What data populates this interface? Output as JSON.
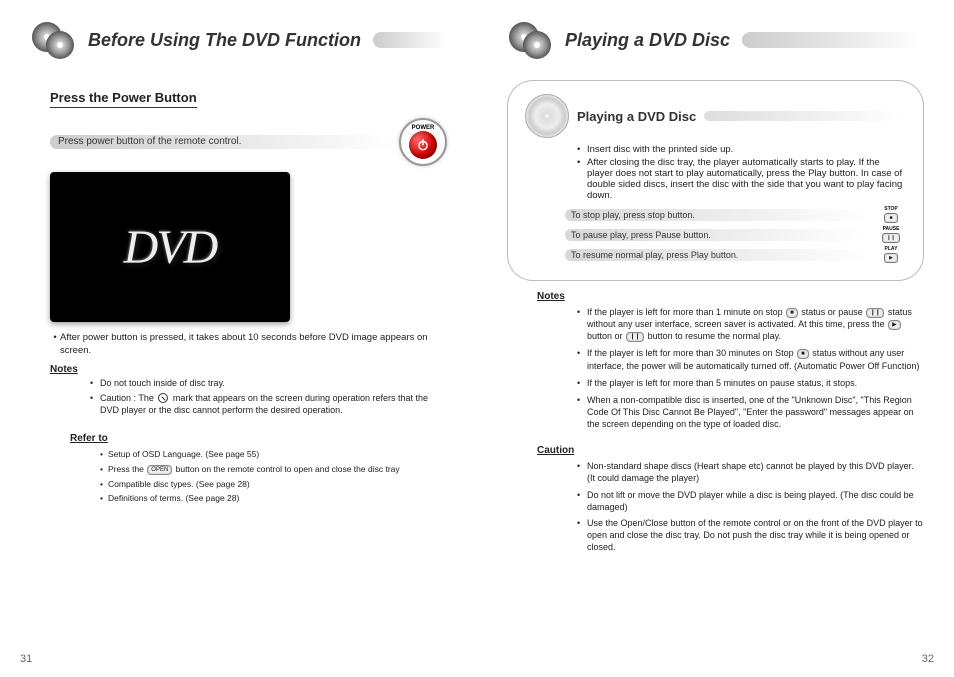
{
  "left": {
    "header": "Before Using The DVD Function",
    "page_num": "31",
    "subheading": "Press the Power Button",
    "pressline": "Press power button of the remote control.",
    "power_label": "POWER",
    "dvd_logo": "DVD",
    "note1": "After power button is pressed, it takes about 10 seconds before DVD image appears on screen.",
    "notes_label": "Notes",
    "notes": [
      "Do not touch inside of disc tray.",
      "Caution : The       mark that appears on the screen during operation refers that the DVD player or the disc cannot perform the desired operation."
    ],
    "refer_label": "Refer to",
    "refer": [
      "Setup of OSD Language. (See page 55)",
      "Press the        button on the remote control to open and close the disc tray",
      "Compatible disc types. (See page 28)",
      "Definitions of terms. (See page 28)"
    ],
    "open_btn": "OPEN"
  },
  "right": {
    "header": "Playing a DVD Disc",
    "page_num": "32",
    "box_title": "Playing a DVD Disc",
    "box_points": [
      "Insert disc with the printed side up.",
      "After closing the disc tray, the player automatically starts to play. If the player does not start to play automatically, press the Play button. In case of double sided discs, insert the disc with the side that you want to play facing down."
    ],
    "controls": [
      {
        "label": "To stop play, press stop button.",
        "btn_label": "STOP",
        "btn_text": "■"
      },
      {
        "label": "To pause play, press Pause button.",
        "btn_label": "PAUSE",
        "btn_text": "❙❙"
      },
      {
        "label": "To resume normal play, press Play button.",
        "btn_label": "PLAY",
        "btn_text": "▶"
      }
    ],
    "notes_label": "Notes",
    "notes": [
      "If the player is left for more than 1 minute on stop         status or pause         status without any user interface, screen saver is activated. At this time, press the         button or         button to resume the normal play.",
      "If the player is left for more than 30 minutes on Stop         status without any user interface, the power will be automatically turned off. (Automatic Power Off Function)",
      "If the player is left for more than 5 minutes on pause status, it stops.",
      "When a non-compatible disc is inserted, one of the \"Unknown Disc\", \"This Region Code Of This Disc Cannot Be Played\", \"Enter the password\" messages appear on the screen depending on the type of loaded disc."
    ],
    "warn_label": "Caution",
    "warns": [
      "Non-standard shape discs (Heart shape etc) cannot be played by this DVD player. (It could damage the player)",
      "Do not lift or move the DVD player while a disc is being played. (The disc could be damaged)",
      "Use the Open/Close button of the remote control or on the front of the DVD player to open and close the disc tray. Do not push the disc tray while it is being opened or closed."
    ],
    "btn_stop": "■",
    "btn_pause": "❙❙",
    "btn_play": "▶"
  }
}
